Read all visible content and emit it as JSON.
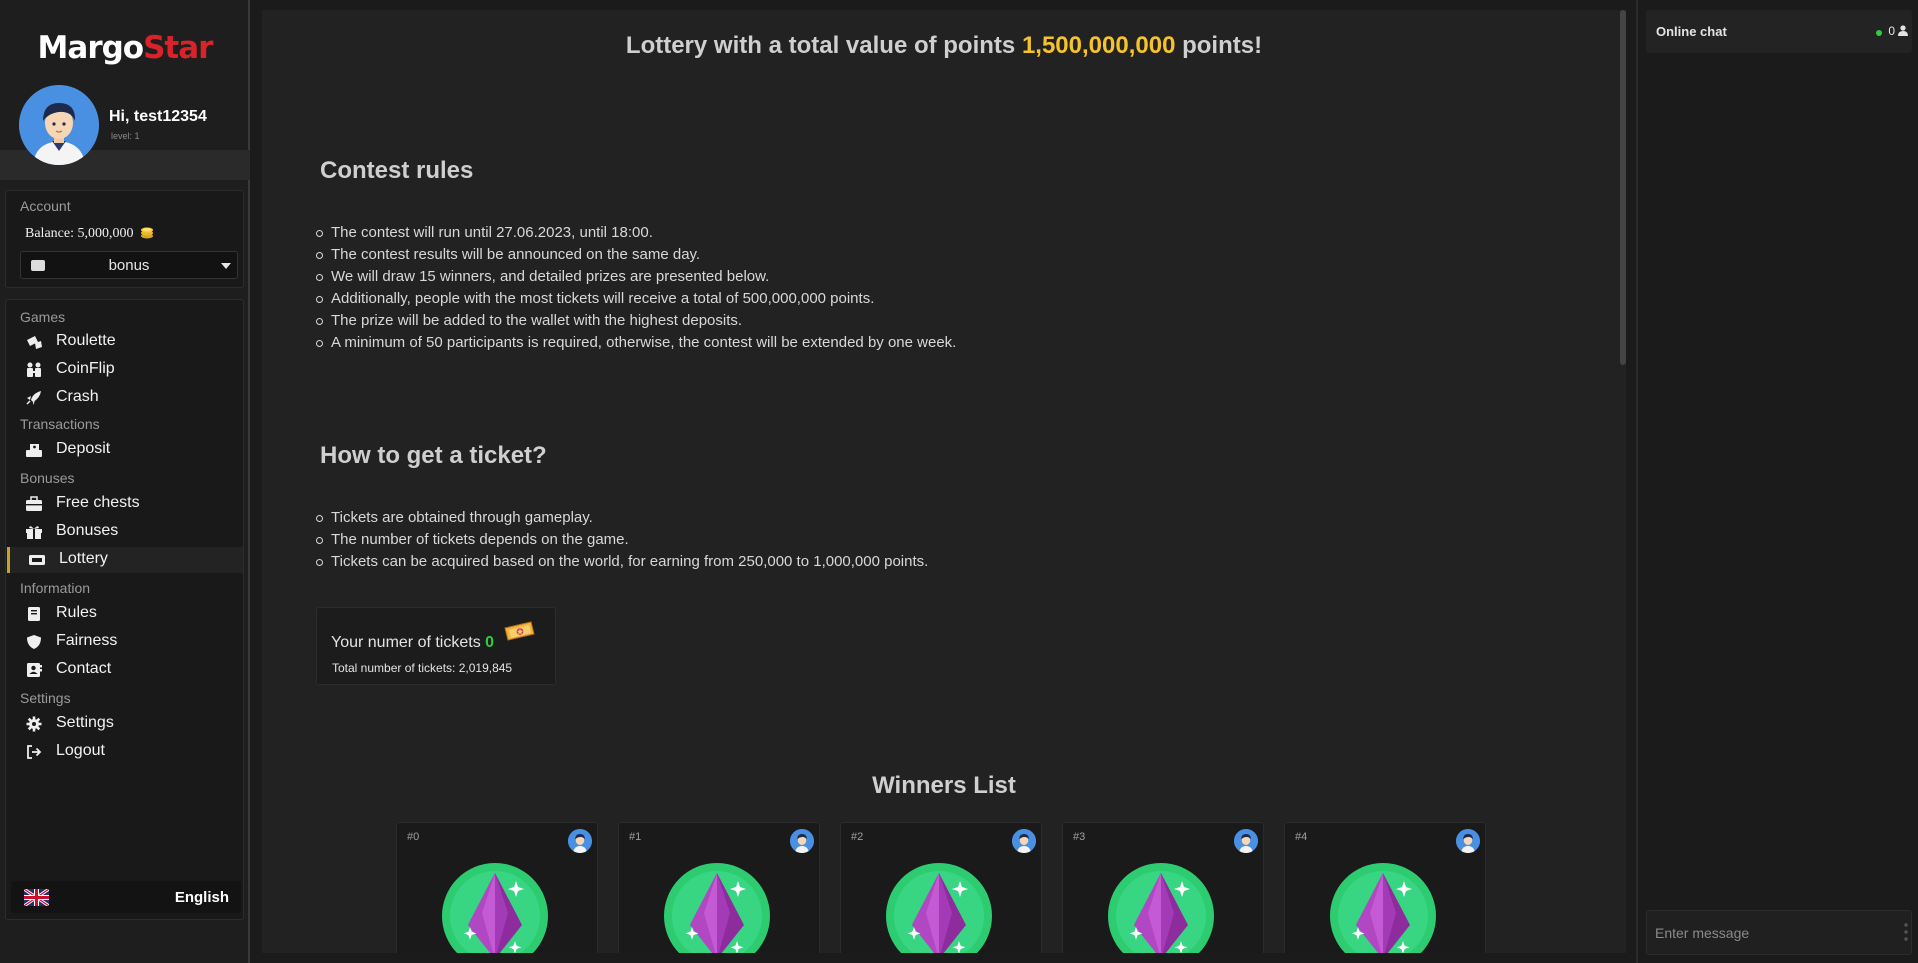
{
  "app": {
    "logo_part1": "Margo",
    "logo_part2": "Star",
    "accent_red": "#d8232a",
    "accent_gold": "#f6c32b"
  },
  "user": {
    "greeting": "Hi, test12354",
    "level": "level: 1"
  },
  "account": {
    "title": "Account",
    "balance_label": "Balance:",
    "balance_value": "5,000,000",
    "wallet": "bonus"
  },
  "nav": {
    "sections": {
      "games": "Games",
      "transactions": "Transactions",
      "bonuses": "Bonuses",
      "information": "Information",
      "settings": "Settings"
    },
    "items": {
      "roulette": "Roulette",
      "coinflip": "CoinFlip",
      "crash": "Crash",
      "deposit": "Deposit",
      "free_chests": "Free chests",
      "bonuses": "Bonuses",
      "lottery": "Lottery",
      "rules": "Rules",
      "fairness": "Fairness",
      "contact": "Contact",
      "settings": "Settings",
      "logout": "Logout"
    },
    "active": "lottery"
  },
  "language": "English",
  "main": {
    "headline_prefix": "Lottery with a total value of points",
    "headline_amount": "1,500,000,000",
    "headline_suffix": "points!",
    "rules_title": "Contest rules",
    "rules": [
      "The contest will run until 27.06.2023, until 18:00.",
      "The contest results will be announced on the same day.",
      "We will draw 15 winners, and detailed prizes are presented below.",
      "Additionally, people with the most tickets will receive a total of 500,000,000 points.",
      "The prize will be added to the wallet with the highest deposits.",
      "A minimum of 50 participants is required, otherwise, the contest will be extended by one week."
    ],
    "ticket_title": "How to get a ticket?",
    "ticket_rules": [
      "Tickets are obtained through gameplay.",
      "The number of tickets depends on the game.",
      "Tickets can be acquired based on the world, for earning from 250,000 to 1,000,000 points."
    ],
    "ticket_label": "Your numer of tickets",
    "ticket_count": "0",
    "ticket_total": "Total number of tickets: 2,019,845",
    "winners_title": "Winners List",
    "winners": [
      {
        "rank": "#0"
      },
      {
        "rank": "#1"
      },
      {
        "rank": "#2"
      },
      {
        "rank": "#3"
      },
      {
        "rank": "#4"
      }
    ]
  },
  "chat": {
    "title": "Online chat",
    "online_count": "0",
    "input_placeholder": "Enter message"
  }
}
